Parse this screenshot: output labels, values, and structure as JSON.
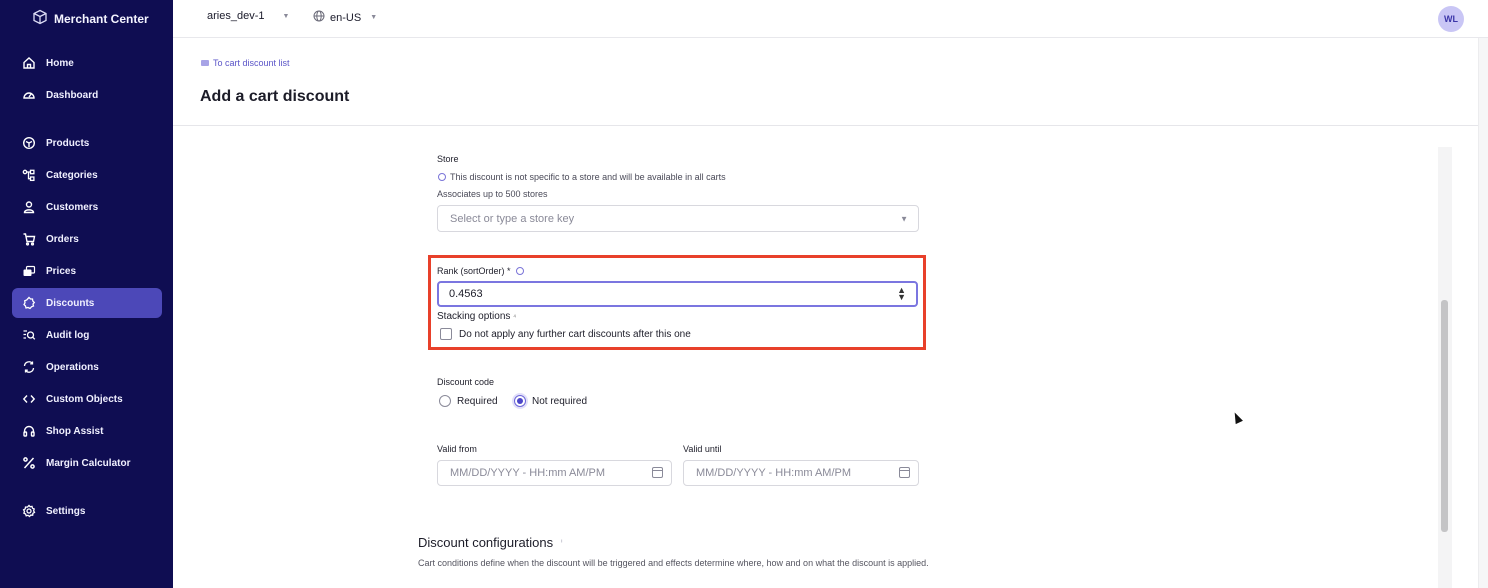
{
  "app": {
    "brand_name": "Merchant Center"
  },
  "sidebar": {
    "items": [
      {
        "label": "Home",
        "icon": "home-icon",
        "active": false
      },
      {
        "label": "Dashboard",
        "icon": "dashboard-icon",
        "active": false
      },
      {
        "label": "Products",
        "icon": "products-icon",
        "active": false
      },
      {
        "label": "Categories",
        "icon": "categories-icon",
        "active": false
      },
      {
        "label": "Customers",
        "icon": "customers-icon",
        "active": false
      },
      {
        "label": "Orders",
        "icon": "cart-icon",
        "active": false
      },
      {
        "label": "Prices",
        "icon": "prices-icon",
        "active": false
      },
      {
        "label": "Discounts",
        "icon": "discount-icon",
        "active": true
      },
      {
        "label": "Audit log",
        "icon": "audit-log-icon",
        "active": false
      },
      {
        "label": "Operations",
        "icon": "operations-icon",
        "active": false
      },
      {
        "label": "Custom Objects",
        "icon": "code-icon",
        "active": false
      },
      {
        "label": "Shop Assist",
        "icon": "headset-icon",
        "active": false
      },
      {
        "label": "Margin Calculator",
        "icon": "percent-icon",
        "active": false
      },
      {
        "label": "Settings",
        "icon": "gear-icon",
        "active": false
      }
    ]
  },
  "topbar": {
    "project": "aries_dev-1",
    "locale": "en-US",
    "avatar_initials": "WL"
  },
  "header": {
    "back_link": "To cart discount list",
    "title": "Add a cart discount"
  },
  "form": {
    "store": {
      "label": "Store",
      "info": "This discount is not specific to a store and will be available in all carts",
      "helper": "Associates up to 500 stores",
      "placeholder": "Select or type a store key"
    },
    "rank": {
      "label": "Rank (sortOrder) *",
      "value": "0.4563"
    },
    "stacking": {
      "label": "Stacking options",
      "checkbox_label": "Do not apply any further cart discounts after this one",
      "checked": false
    },
    "discount_code": {
      "label": "Discount code",
      "options": [
        "Required",
        "Not required"
      ],
      "selected": "Not required"
    },
    "valid_from": {
      "label": "Valid from",
      "placeholder": "MM/DD/YYYY - HH:mm AM/PM"
    },
    "valid_until": {
      "label": "Valid until",
      "placeholder": "MM/DD/YYYY - HH:mm AM/PM"
    }
  },
  "configurations": {
    "title": "Discount configurations",
    "description": "Cart conditions define when the discount will be triggered and effects determine where, how and on what the discount is applied."
  },
  "colors": {
    "sidebar_bg": "#0f0d52",
    "active_nav": "#4c48b8",
    "accent": "#5b55c8",
    "highlight": "#e8402a"
  }
}
